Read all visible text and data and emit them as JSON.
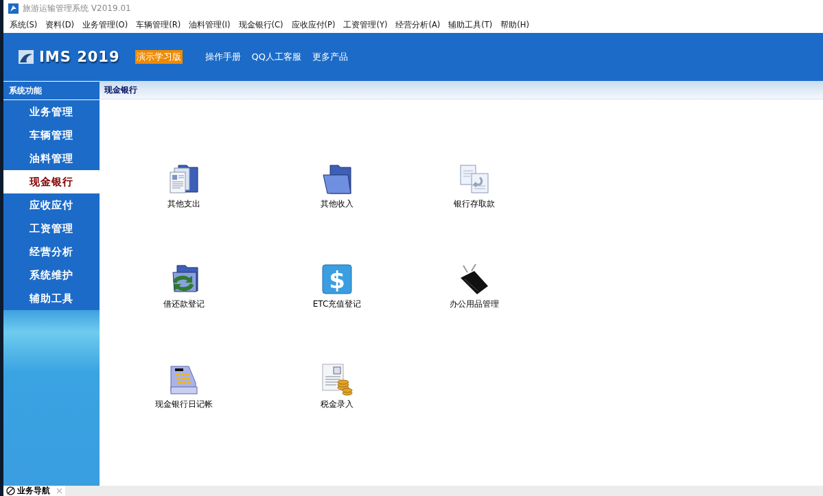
{
  "window": {
    "title": "旅游运输管理系统 V2019.01"
  },
  "menu_bar": [
    "系统(S)",
    "资料(D)",
    "业务管理(O)",
    "车辆管理(R)",
    "油料管理(I)",
    "现金银行(C)",
    "应收应付(P)",
    "工资管理(Y)",
    "经营分析(A)",
    "辅助工具(T)",
    "帮助(H)"
  ],
  "banner": {
    "logo": "IMS 2019",
    "badge": "演示学习版",
    "links": [
      "操作手册",
      "QQ人工客服",
      "更多产品"
    ]
  },
  "sidebar": {
    "title": "系统功能",
    "items": [
      {
        "label": "业务管理",
        "selected": false
      },
      {
        "label": "车辆管理",
        "selected": false
      },
      {
        "label": "油料管理",
        "selected": false
      },
      {
        "label": "现金银行",
        "selected": true
      },
      {
        "label": "应收应付",
        "selected": false
      },
      {
        "label": "工资管理",
        "selected": false
      },
      {
        "label": "经营分析",
        "selected": false
      },
      {
        "label": "系统维护",
        "selected": false
      },
      {
        "label": "辅助工具",
        "selected": false
      }
    ]
  },
  "content": {
    "title": "现金银行",
    "items": [
      {
        "label": "其他支出",
        "kind": "docs"
      },
      {
        "label": "其他收入",
        "kind": "folder"
      },
      {
        "label": "银行存取款",
        "kind": "transfer"
      },
      {
        "label": "借还款登记",
        "kind": "refresh"
      },
      {
        "label": "ETC充值登记",
        "kind": "dollar",
        "glyph": "$"
      },
      {
        "label": "办公用品管理",
        "kind": "clip"
      },
      {
        "label": "现金银行日记帐",
        "kind": "register"
      },
      {
        "label": "税金录入",
        "kind": "tax"
      }
    ]
  },
  "bottom_tabs": [
    {
      "label": "业务导航",
      "selected": true
    }
  ]
}
